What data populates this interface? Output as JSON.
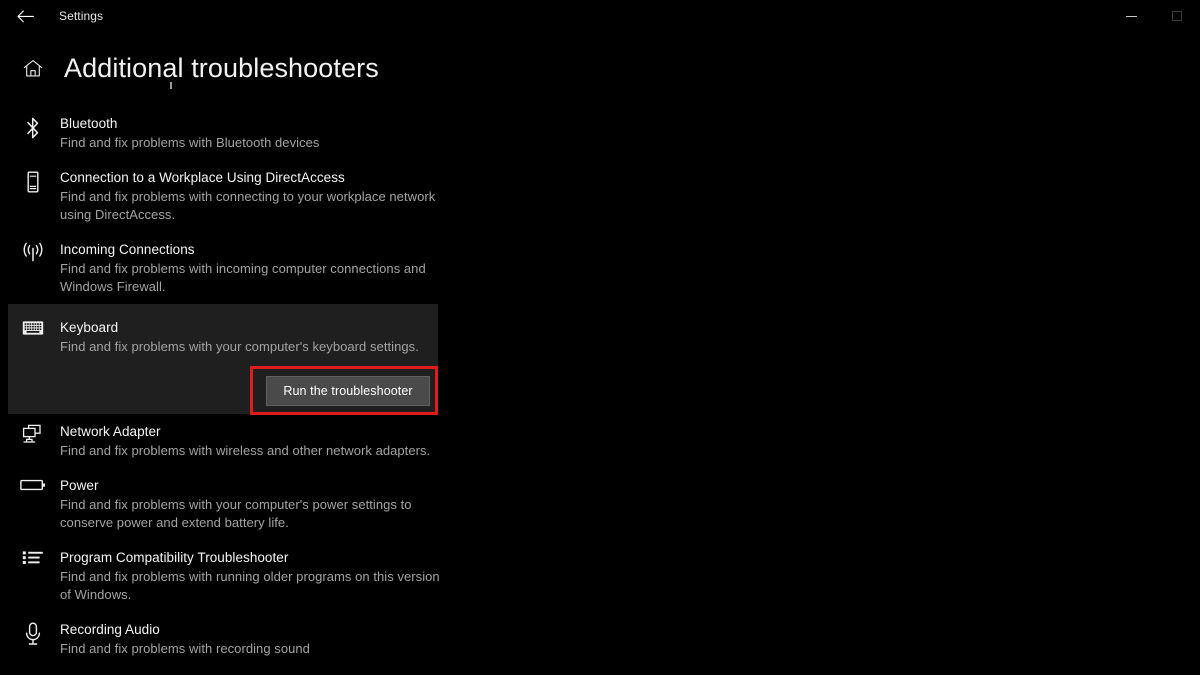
{
  "window": {
    "titlebar_text": "Settings",
    "back_icon": "back-arrow-icon",
    "controls": {
      "minimize_label": "Minimize",
      "maximize_label": "Maximize"
    }
  },
  "header": {
    "home_icon": "home-icon",
    "title": "Additional troubleshooters"
  },
  "colors": {
    "page_background": "#000000",
    "selected_row_background": "#1f1f1f",
    "highlight_border": "#e01b1b",
    "button_background": "#4a4a4a",
    "title_text": "#f2f2f2",
    "description_text": "#a3a3a3"
  },
  "list": {
    "items": [
      {
        "icon": "bluetooth-icon",
        "title": "Bluetooth",
        "description": "Find and fix problems with Bluetooth devices",
        "selected": false
      },
      {
        "icon": "mobile-device-icon",
        "title": "Connection to a Workplace Using DirectAccess",
        "description": "Find and fix problems with connecting to your workplace network using DirectAccess.",
        "selected": false
      },
      {
        "icon": "broadcast-antenna-icon",
        "title": "Incoming Connections",
        "description": "Find and fix problems with incoming computer connections and Windows Firewall.",
        "selected": false
      },
      {
        "icon": "keyboard-icon",
        "title": "Keyboard",
        "description": "Find and fix problems with your computer's keyboard settings.",
        "selected": true,
        "action_button": "Run the troubleshooter"
      },
      {
        "icon": "network-adapter-icon",
        "title": "Network Adapter",
        "description": "Find and fix problems with wireless and other network adapters.",
        "selected": false
      },
      {
        "icon": "battery-icon",
        "title": "Power",
        "description": "Find and fix problems with your computer's power settings to conserve power and extend battery life.",
        "selected": false
      },
      {
        "icon": "list-icon",
        "title": "Program Compatibility Troubleshooter",
        "description": "Find and fix problems with running older programs on this version of Windows.",
        "selected": false
      },
      {
        "icon": "microphone-icon",
        "title": "Recording Audio",
        "description": "Find and fix problems with recording sound",
        "selected": false
      }
    ]
  }
}
